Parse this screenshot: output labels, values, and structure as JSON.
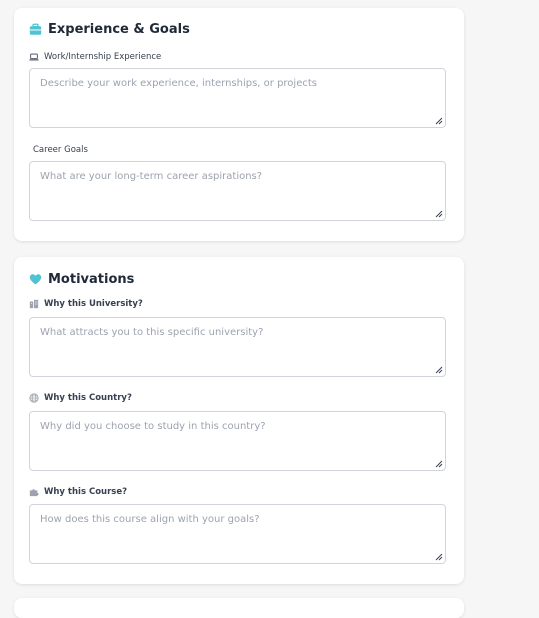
{
  "experience_section": {
    "title": "Experience & Goals",
    "title_icon": "briefcase-icon",
    "work_label": "Work/Internship Experience",
    "work_icon": "laptop-icon",
    "work_placeholder": "Describe your work experience, internships, or projects",
    "career_label": "Career Goals",
    "career_placeholder": "What are your long-term career aspirations?"
  },
  "motivations_section": {
    "title": "Motivations",
    "title_icon": "heart-icon",
    "university_label": "Why this University?",
    "university_icon": "building-icon",
    "university_placeholder": "What attracts you to this specific university?",
    "country_label": "Why this Country?",
    "country_icon": "globe-icon",
    "country_placeholder": "Why did you choose to study in this country?",
    "course_label": "Why this Course?",
    "course_icon": "puzzle-icon",
    "course_placeholder": "How does this course align with your goals?"
  },
  "colors": {
    "accent": "#4fc3d3",
    "title_text": "#1f2937",
    "placeholder": "#9ca3af",
    "border": "#d1d5db"
  }
}
